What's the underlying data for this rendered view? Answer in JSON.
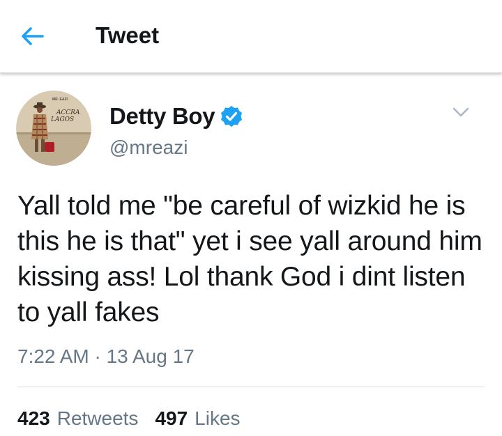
{
  "header": {
    "title": "Tweet",
    "back_icon": "arrow-left-icon"
  },
  "tweet": {
    "author": {
      "display_name": "Detty Boy",
      "handle": "@mreazi",
      "verified": true
    },
    "text": "Yall told me \"be careful of wizkid he is this he is that\" yet i see yall around him kissing ass! Lol thank God i dint listen to yall fakes",
    "timestamp": "7:22 AM · 13 Aug 17",
    "stats": {
      "retweets_count": "423",
      "retweets_label": "Retweets",
      "likes_count": "497",
      "likes_label": "Likes"
    }
  },
  "avatar_text": {
    "line1": "ACCRA",
    "line2": "LAGOS"
  },
  "colors": {
    "accent": "#1da1f2",
    "text_primary": "#14171a",
    "text_secondary": "#657786",
    "divider": "#d9dfe3"
  }
}
